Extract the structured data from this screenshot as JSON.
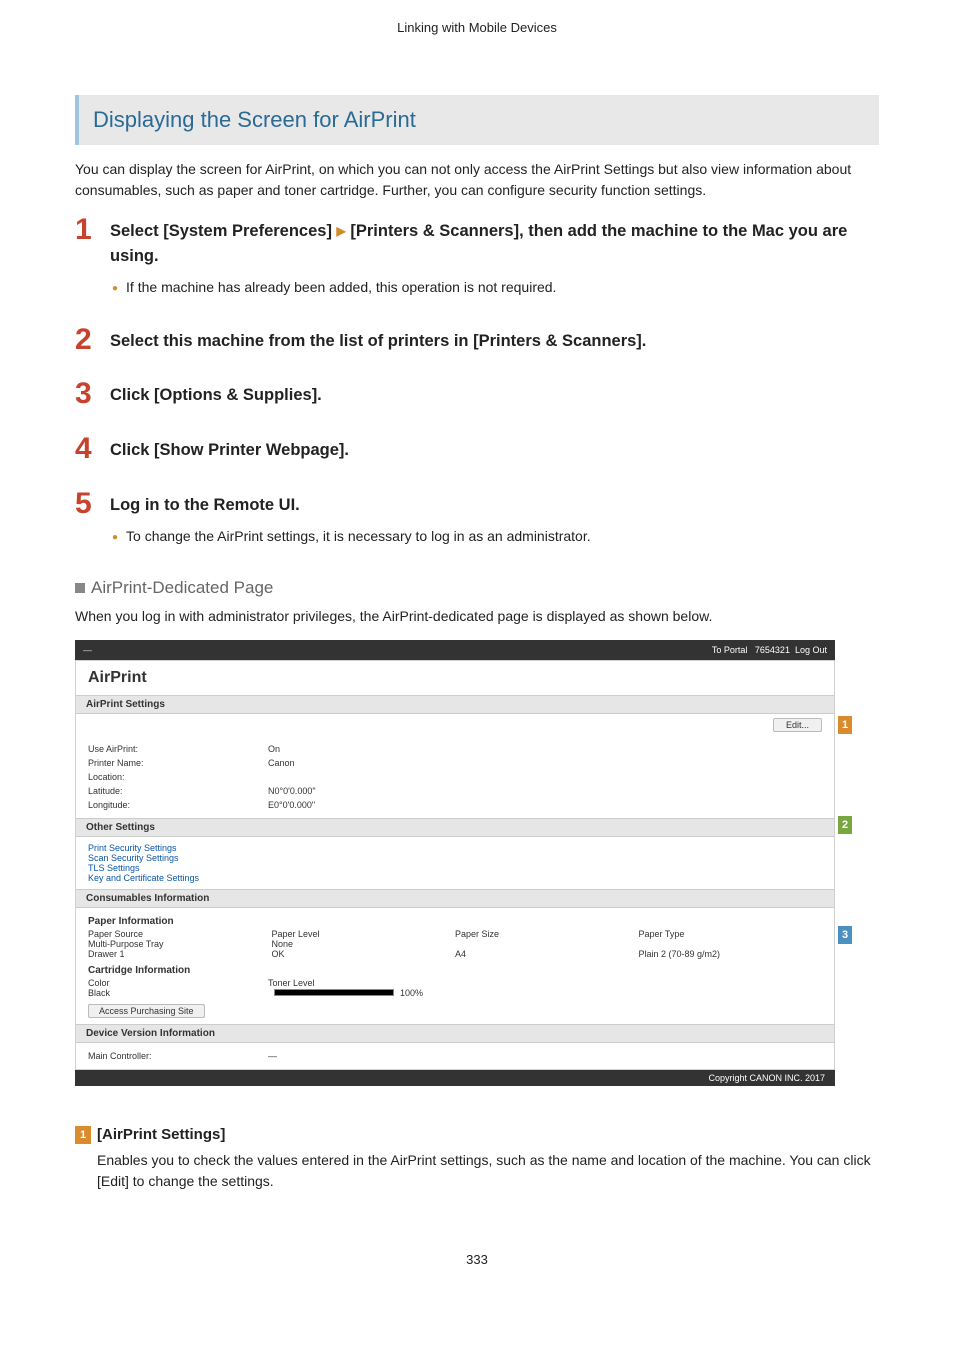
{
  "header": "Linking with Mobile Devices",
  "section_title": "Displaying the Screen for AirPrint",
  "intro": "You can display the screen for AirPrint, on which you can not only access the AirPrint Settings but also view information about consumables, such as paper and toner cartridge. Further, you can configure security function settings.",
  "steps": [
    {
      "num": "1",
      "title_a": "Select [System Preferences] ",
      "tri": "▶",
      "title_b": " [Printers & Scanners], then add the machine to the Mac you are using.",
      "bullet": "If the machine has already been added, this operation is not required."
    },
    {
      "num": "2",
      "title_a": "Select this machine from the list of printers in [Printers & Scanners].",
      "title_b": "",
      "bullet": ""
    },
    {
      "num": "3",
      "title_a": "Click [Options & Supplies].",
      "title_b": "",
      "bullet": ""
    },
    {
      "num": "4",
      "title_a": "Click [Show Printer Webpage].",
      "title_b": "",
      "bullet": ""
    },
    {
      "num": "5",
      "title_a": "Log in to the Remote UI.",
      "title_b": "",
      "bullet": "To change the AirPrint settings, it is necessary to log in as an administrator."
    }
  ],
  "subhead": "AirPrint-Dedicated Page",
  "subtext": "When you log in with administrator privileges, the AirPrint-dedicated page is displayed as shown below.",
  "ui": {
    "topbar_right_portal": "To Portal",
    "topbar_right_user": "7654321",
    "topbar_right_logout": "Log Out",
    "title": "AirPrint",
    "sec_settings": "AirPrint Settings",
    "edit": "Edit...",
    "use_airprint_k": "Use AirPrint:",
    "use_airprint_v": "On",
    "printer_name_k": "Printer Name:",
    "printer_name_v": "Canon",
    "location_k": "Location:",
    "location_v": "",
    "latitude_k": "Latitude:",
    "latitude_v": "N0°0'0.000\"",
    "longitude_k": "Longitude:",
    "longitude_v": "E0°0'0.000\"",
    "sec_other": "Other Settings",
    "links": [
      "Print Security Settings",
      "Scan Security Settings",
      "TLS Settings",
      "Key and Certificate Settings"
    ],
    "sec_consumables": "Consumables Information",
    "paper_info": "Paper Information",
    "pcols": [
      "Paper Source",
      "Paper Level",
      "Paper Size",
      "Paper Type"
    ],
    "prow1": [
      "Multi-Purpose Tray",
      "None",
      "",
      ""
    ],
    "prow2": [
      "Drawer 1",
      "OK",
      "A4",
      "Plain 2 (70-89 g/m2)"
    ],
    "cart_info": "Cartridge Information",
    "cart_cols": [
      "Color",
      "Toner Level"
    ],
    "cart_row": [
      "Black",
      "100%"
    ],
    "access_site": "Access Purchasing Site",
    "sec_device": "Device Version Information",
    "main_ctrl": "Main Controller:",
    "footer": "Copyright CANON INC. 2017"
  },
  "legend": {
    "badge": "1",
    "title": "[AirPrint Settings]",
    "body": "Enables you to check the values entered in the AirPrint settings, such as the name and location of the machine. You can click [Edit] to change the settings."
  },
  "page_num": "333"
}
